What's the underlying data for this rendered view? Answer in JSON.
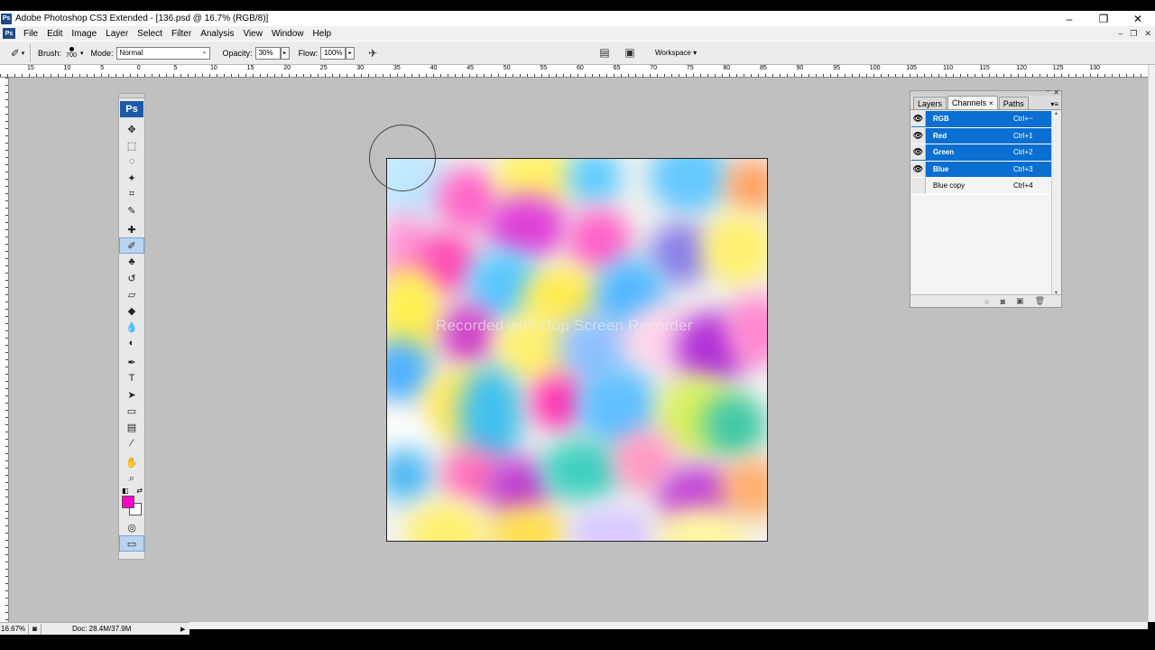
{
  "window": {
    "title": "Adobe Photoshop CS3 Extended - [136.psd @ 16.7% (RGB/8)]",
    "app_icon": "Ps",
    "controls": [
      "–",
      "❐",
      "✕"
    ]
  },
  "menu": {
    "icon": "Ps",
    "items": [
      "File",
      "Edit",
      "Image",
      "Layer",
      "Select",
      "Filter",
      "Analysis",
      "View",
      "Window",
      "Help"
    ],
    "doc_controls": [
      "–",
      "❐",
      "✕"
    ]
  },
  "options": {
    "brush_label": "Brush:",
    "brush_size": "700",
    "mode_label": "Mode:",
    "mode_value": "Normal",
    "opacity_label": "Opacity:",
    "opacity_value": "30%",
    "flow_label": "Flow:",
    "flow_value": "100%",
    "workspace_label": "Workspace ▾"
  },
  "ruler": {
    "top_numbers": [
      "15",
      "10",
      "5",
      "0",
      "5",
      "10",
      "15",
      "20",
      "25",
      "30",
      "35",
      "40",
      "45",
      "50",
      "55",
      "60",
      "65",
      "70",
      "75",
      "80",
      "85",
      "90",
      "95",
      "100",
      "105",
      "110",
      "115",
      "120",
      "125",
      "130"
    ]
  },
  "toolbox": {
    "logo": "Ps",
    "tools": [
      {
        "name": "move-tool",
        "glyph": "✥"
      },
      {
        "name": "marquee-tool",
        "glyph": "⬚"
      },
      {
        "name": "lasso-tool",
        "glyph": "◌"
      },
      {
        "name": "magic-wand-tool",
        "glyph": "✦"
      },
      {
        "name": "crop-tool",
        "glyph": "⌗"
      },
      {
        "name": "eyedropper-slice-tool",
        "glyph": "✎"
      },
      {
        "name": "healing-brush-tool",
        "glyph": "✚"
      },
      {
        "name": "brush-tool",
        "glyph": "✐"
      },
      {
        "name": "clone-stamp-tool",
        "glyph": "♣"
      },
      {
        "name": "history-brush-tool",
        "glyph": "↺"
      },
      {
        "name": "eraser-tool",
        "glyph": "▱"
      },
      {
        "name": "paint-bucket-tool",
        "glyph": "◆"
      },
      {
        "name": "blur-tool",
        "glyph": "💧"
      },
      {
        "name": "dodge-tool",
        "glyph": "◐"
      },
      {
        "name": "pen-tool",
        "glyph": "✒"
      },
      {
        "name": "type-tool",
        "glyph": "T"
      },
      {
        "name": "path-selection-tool",
        "glyph": "➤"
      },
      {
        "name": "rectangle-tool",
        "glyph": "▭"
      },
      {
        "name": "notes-tool",
        "glyph": "▤"
      },
      {
        "name": "eyedropper-tool",
        "glyph": "⁄"
      },
      {
        "name": "hand-tool",
        "glyph": "✋"
      },
      {
        "name": "zoom-tool",
        "glyph": "⌕"
      }
    ],
    "foreground_color": "#ff00c8",
    "background_color": "#ffffff",
    "quick_mask": "◎",
    "screen_mode": "▭"
  },
  "watermark": "Recorded with iTop Screen Recorder",
  "channels_panel": {
    "tabs": [
      {
        "label": "Layers",
        "active": false
      },
      {
        "label": "Channels",
        "active": true
      },
      {
        "label": "Paths",
        "active": false
      }
    ],
    "channels": [
      {
        "name": "RGB",
        "shortcut": "Ctrl+~",
        "selected": true,
        "visible": true
      },
      {
        "name": "Red",
        "shortcut": "Ctrl+1",
        "selected": true,
        "visible": true
      },
      {
        "name": "Green",
        "shortcut": "Ctrl+2",
        "selected": true,
        "visible": true
      },
      {
        "name": "Blue",
        "shortcut": "Ctrl+3",
        "selected": true,
        "visible": true
      },
      {
        "name": "Blue copy",
        "shortcut": "Ctrl+4",
        "selected": false,
        "visible": false
      }
    ],
    "footer_icons": [
      "○",
      "◙",
      "▣",
      "🗑"
    ]
  },
  "status": {
    "zoom": "16.67%",
    "doc": "Doc: 28.4M/37.9M"
  },
  "colors": {
    "selection_blue": "#0a6fd1",
    "workspace_gray": "#c0c0c0"
  }
}
